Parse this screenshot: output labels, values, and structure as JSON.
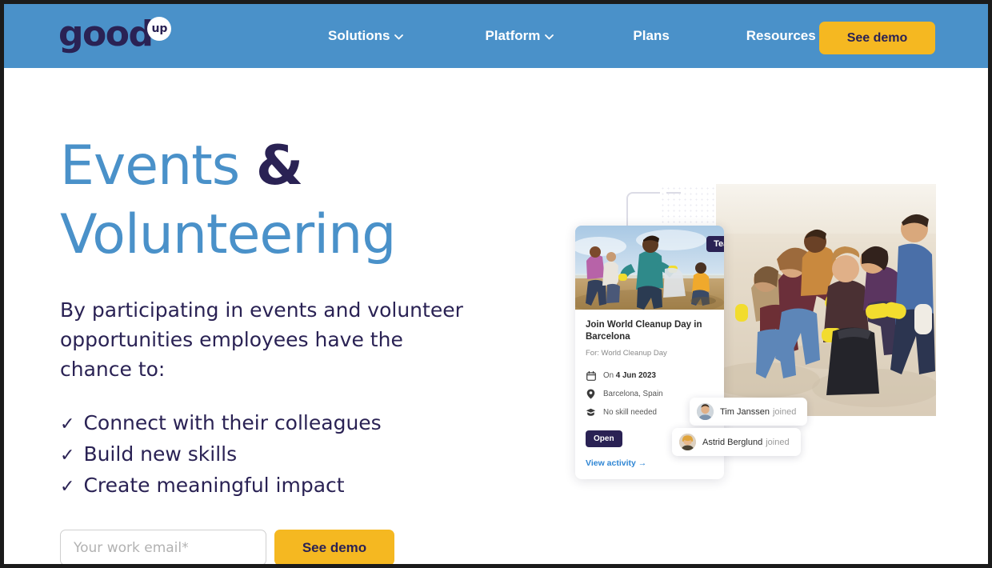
{
  "header": {
    "logo_word": "good",
    "logo_badge": "up",
    "nav": [
      {
        "label": "Solutions",
        "has_chevron": true
      },
      {
        "label": "Platform",
        "has_chevron": true
      },
      {
        "label": "Plans",
        "has_chevron": false
      },
      {
        "label": "Resources",
        "has_chevron": true
      }
    ],
    "cta_label": "See demo",
    "background_color": "#4a91c9",
    "cta_color": "#f5b821"
  },
  "hero": {
    "title_line1_a": "Events ",
    "title_line1_amp": "&",
    "title_line2": "Volunteering",
    "subtitle": "By participating in events and volunteer opportunities employees have the chance to:",
    "benefits": [
      {
        "check": "✓",
        "label": "Connect with their colleagues"
      },
      {
        "check": "✓",
        "label": "Build new skills"
      },
      {
        "check": "✓",
        "label": "Create meaningful impact"
      }
    ],
    "email_placeholder": "Your work email*",
    "email_value": "",
    "form_cta_label": "See demo",
    "title_color": "#4a91c9",
    "amp_color": "#2a2254",
    "text_color": "#2a2254"
  },
  "activity_card": {
    "team_badge": "Team",
    "title": "Join World Cleanup Day in Barcelona",
    "for_label": "For: World Cleanup Day",
    "meta": [
      {
        "icon": "calendar-icon",
        "prefix": "On ",
        "value": "4 Jun 2023"
      },
      {
        "icon": "location-pin-icon",
        "prefix": "",
        "value": "Barcelona, Spain"
      },
      {
        "icon": "skill-icon",
        "prefix": "",
        "value": "No skill needed"
      }
    ],
    "status_badge": "Open",
    "view_activity_label": "View activity →",
    "badge_color": "#2a2254",
    "link_color": "#2f86d4"
  },
  "notifications": [
    {
      "name": "Tim Janssen",
      "action": "joined"
    },
    {
      "name": "Astrid Berglund",
      "action": "joined"
    }
  ]
}
